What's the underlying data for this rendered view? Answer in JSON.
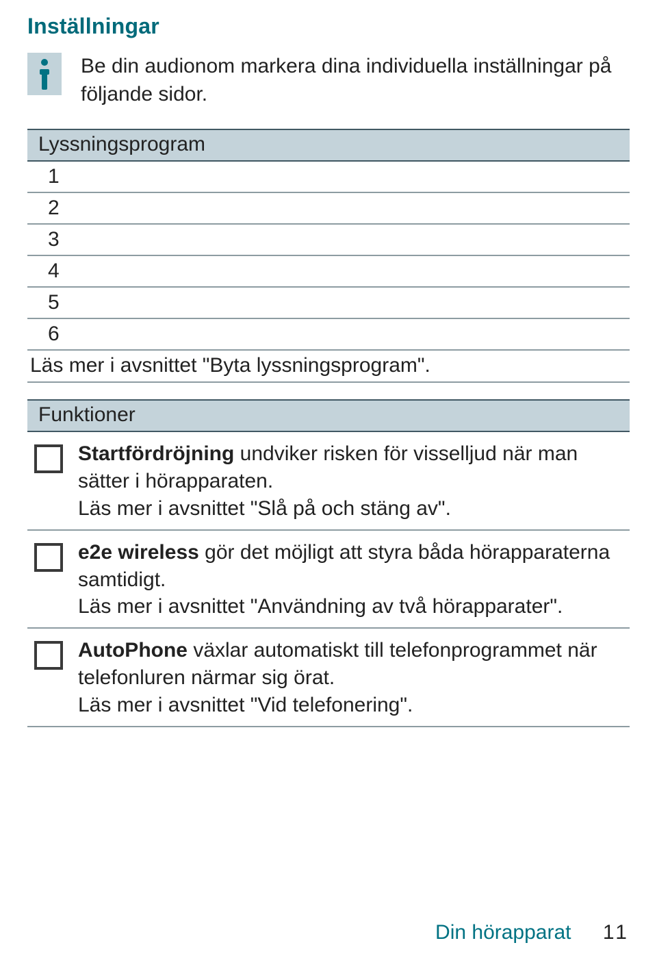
{
  "title": "Inställningar",
  "info_note": "Be din audionom markera dina individuella inställningar på följande sidor.",
  "programs": {
    "header": "Lyssningsprogram",
    "rows": [
      "1",
      "2",
      "3",
      "4",
      "5",
      "6"
    ],
    "footnote": "Läs mer i avsnittet \"Byta lyssningsprogram\"."
  },
  "functions": {
    "header": "Funktioner",
    "items": [
      {
        "bold": "Startfördröjning",
        "rest": " undviker risken för visselljud när man sätter i hörapparaten.",
        "more": "Läs mer i avsnittet \"Slå på och stäng av\"."
      },
      {
        "bold": "e2e wireless",
        "rest": " gör det möjligt att styra båda hörapparaterna samtidigt.",
        "more": "Läs mer i avsnittet \"Användning av två hörapparater\"."
      },
      {
        "bold": "AutoPhone",
        "rest": " växlar automatiskt till telefonprogrammet när telefonluren närmar sig örat.",
        "more": "Läs mer i avsnittet \"Vid telefonering\"."
      }
    ]
  },
  "footer": {
    "section": "Din hörapparat",
    "page": "11"
  }
}
